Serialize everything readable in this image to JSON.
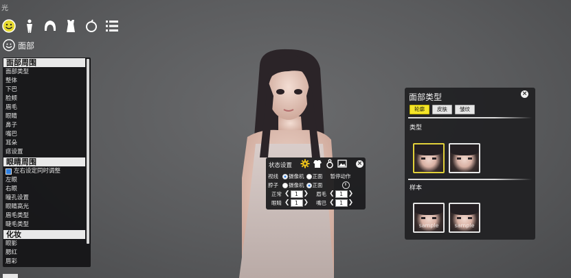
{
  "top_hint": "光",
  "categories": [
    {
      "name": "face",
      "icon": "smile-icon",
      "active": true
    },
    {
      "name": "body",
      "icon": "body-icon",
      "active": false
    },
    {
      "name": "hair",
      "icon": "hair-icon",
      "active": false
    },
    {
      "name": "clothes",
      "icon": "clothing-icon",
      "active": false
    },
    {
      "name": "accessory",
      "icon": "accessory-icon",
      "active": false
    },
    {
      "name": "list",
      "icon": "list-icon",
      "active": false
    }
  ],
  "section_title": "面部",
  "left_panel": {
    "groups": [
      {
        "header": "面部周围",
        "items": [
          "面部类型",
          "整体",
          "下巴",
          "脸颊",
          "眉毛",
          "眼睛",
          "鼻子",
          "嘴巴",
          "耳朵",
          "痣设置"
        ]
      },
      {
        "header": "眼睛周围",
        "checkbox": "左右设定同时调整",
        "items": [
          "左眼",
          "右眼",
          "瞳孔设置",
          "眼睛高光",
          "眉毛类型",
          "睫毛类型"
        ]
      },
      {
        "header": "化妆",
        "items": [
          "眼影",
          "腮红",
          "唇彩"
        ]
      }
    ]
  },
  "right_panel": {
    "title": "面部类型",
    "tabs": [
      "轮廓",
      "皮肤",
      "皱纹"
    ],
    "active_tab": 0,
    "type_label": "类型",
    "sample_label": "样本",
    "sample_watermark": "sample",
    "close": "×"
  },
  "state_panel": {
    "title": "状态设置",
    "close": "×",
    "row1": {
      "label": "视线",
      "opt1": "摄像机",
      "opt2": "正面",
      "selected": 0,
      "extra": "暂停动作"
    },
    "row2": {
      "label": "脖子",
      "opt1": "摄像机",
      "opt2": "正面",
      "selected": 1
    },
    "row3": {
      "label_left": "正常",
      "value_left": "1",
      "label_right": "眉毛",
      "value_right": "1"
    },
    "row4": {
      "label_left": "眼睛",
      "value_left": "1",
      "label_right": "嘴巴",
      "value_right": "1"
    }
  },
  "colors": {
    "accent": "#f4e52a",
    "radio_on": "#2f7de3",
    "panel_bg": "#141416"
  }
}
